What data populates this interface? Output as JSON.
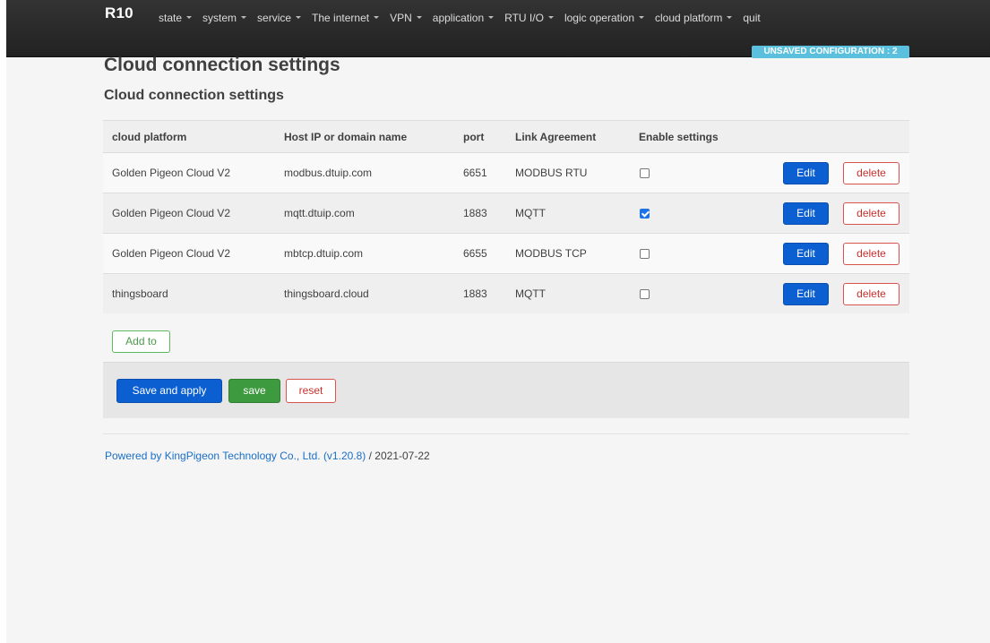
{
  "navbar": {
    "brand": "R10",
    "items": [
      {
        "label": "state",
        "dropdown": true
      },
      {
        "label": "system",
        "dropdown": true
      },
      {
        "label": "service",
        "dropdown": true
      },
      {
        "label": "The internet",
        "dropdown": true
      },
      {
        "label": "VPN",
        "dropdown": true
      },
      {
        "label": "application",
        "dropdown": true
      },
      {
        "label": "RTU I/O",
        "dropdown": true
      },
      {
        "label": "logic operation",
        "dropdown": true
      },
      {
        "label": "cloud platform",
        "dropdown": true
      },
      {
        "label": "quit",
        "dropdown": false
      }
    ],
    "unsaved_badge": "UNSAVED CONFIGURATION : 2"
  },
  "page": {
    "title": "Cloud connection settings",
    "section_title": "Cloud connection settings"
  },
  "table": {
    "headers": [
      "cloud platform",
      "Host IP or domain name",
      "port",
      "Link Agreement",
      "Enable settings"
    ],
    "rows": [
      {
        "platform": "Golden Pigeon Cloud V2",
        "host": "modbus.dtuip.com",
        "port": "6651",
        "protocol": "MODBUS RTU",
        "enabled": false
      },
      {
        "platform": "Golden Pigeon Cloud V2",
        "host": "mqtt.dtuip.com",
        "port": "1883",
        "protocol": "MQTT",
        "enabled": true
      },
      {
        "platform": "Golden Pigeon Cloud V2",
        "host": "mbtcp.dtuip.com",
        "port": "6655",
        "protocol": "MODBUS TCP",
        "enabled": false
      },
      {
        "platform": "thingsboard",
        "host": "thingsboard.cloud",
        "port": "1883",
        "protocol": "MQTT",
        "enabled": false
      }
    ],
    "edit_label": "Edit",
    "delete_label": "delete"
  },
  "buttons": {
    "add": "Add to",
    "save_apply": "Save and apply",
    "save": "save",
    "reset": "reset"
  },
  "footer": {
    "link_text": "Powered by KingPigeon Technology Co., Ltd. (v1.20.8)",
    "date_text": " / 2021-07-22"
  },
  "colors": {
    "primary": "#0b5fd1",
    "success": "#3e9a3e",
    "danger": "#d9534f",
    "info": "#5bc0de"
  }
}
